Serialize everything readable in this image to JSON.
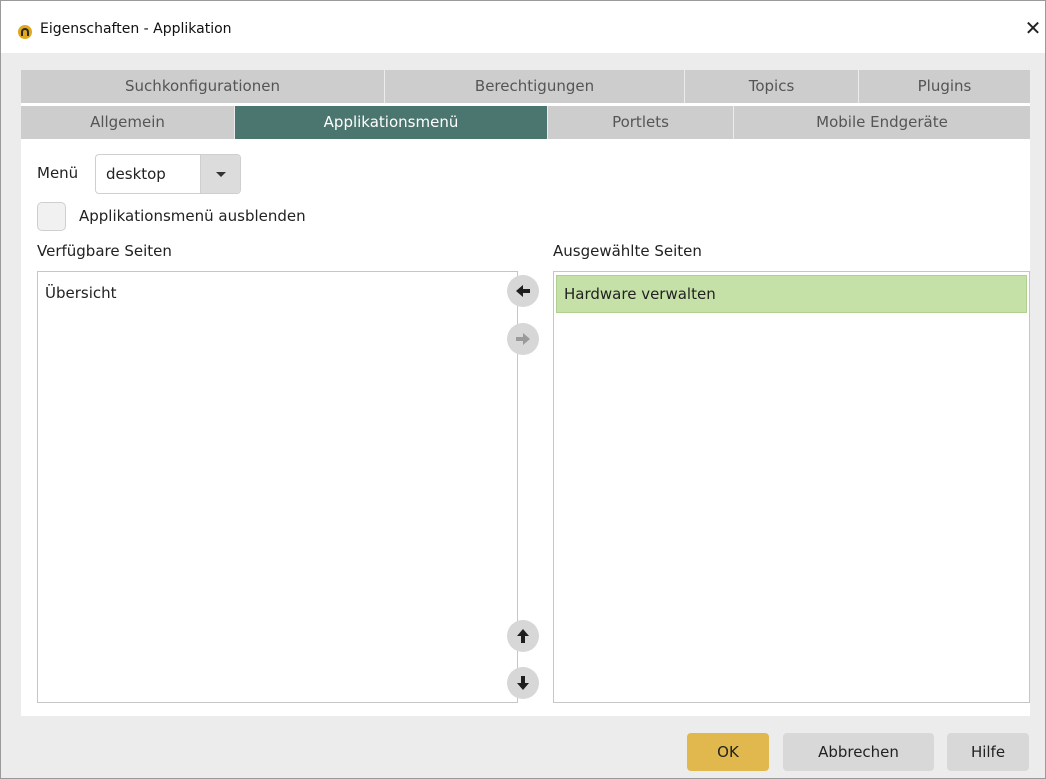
{
  "window": {
    "title": "Eigenschaften - Applikation",
    "close_symbol": "✕"
  },
  "tabs": {
    "row1": [
      "Suchkonfigurationen",
      "Berechtigungen",
      "Topics",
      "Plugins"
    ],
    "row2": [
      "Allgemein",
      "Applikationsmenü",
      "Portlets",
      "Mobile Endgeräte"
    ],
    "active": "Applikationsmenü"
  },
  "menu": {
    "label": "Menü",
    "value": "desktop"
  },
  "hide_menu": {
    "label": "Applikationsmenü ausblenden",
    "checked": false
  },
  "available": {
    "label": "Verfügbare Seiten",
    "items": [
      "Übersicht"
    ]
  },
  "selected": {
    "label": "Ausgewählte Seiten",
    "items": [
      "Hardware verwalten"
    ]
  },
  "buttons": {
    "ok": "OK",
    "cancel": "Abbrechen",
    "help": "Hilfe"
  },
  "colors": {
    "active_tab": "#4b756f",
    "selected_item": "#c6e1a8",
    "ok_button": "#e0b84d"
  },
  "icons": {
    "move_left": "arrow-left-icon",
    "move_right": "arrow-right-icon",
    "move_up": "arrow-up-icon",
    "move_down": "arrow-down-icon"
  }
}
